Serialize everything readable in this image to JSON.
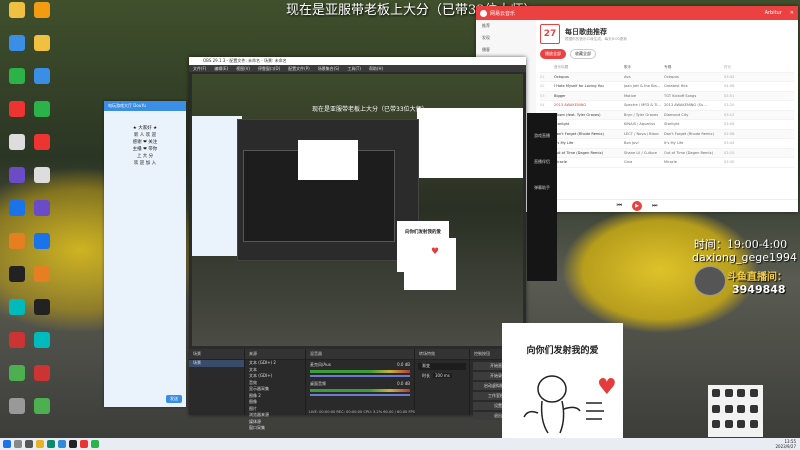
{
  "stream": {
    "title_overlay": "现在是亚服带老板上大分（已带33位大师）",
    "time_text": "时间：19:00-4:00",
    "username": "daxiong_gege1994",
    "platform_label": "斗鱼直播间：",
    "room_number": "3949848",
    "sticker_caption": "向你们发射我的爱",
    "watermark": "吊毛"
  },
  "netease": {
    "app_name": "网易云音乐",
    "user": "Arbitur",
    "sidebar": [
      "推荐",
      "发现",
      "播客",
      "私人漫游",
      "我的",
      "下载管理",
      "最近播放"
    ],
    "date_day": "27",
    "section_title": "每日歌曲推荐",
    "section_sub": "根据你的音乐口味生成，每天6:00更新",
    "play_all": "播放全部",
    "collect_all": "收藏全部",
    "columns": [
      "音乐标题",
      "歌手",
      "专辑",
      "时长"
    ],
    "songs": [
      {
        "n": "01",
        "title": "Octopus",
        "artist": "Ava",
        "album": "Octopus",
        "dur": "03:42"
      },
      {
        "n": "02",
        "title": "I Hate Myself for Loving You",
        "artist": "Joan Jett & the Bla...",
        "album": "Greatest Hits",
        "dur": "04:08"
      },
      {
        "n": "03",
        "title": "Bigger",
        "artist": "Motive",
        "album": "TGT Kickoff Songs",
        "dur": "03:51"
      },
      {
        "n": "04",
        "title": "2013 AWAKENING",
        "artist": "Spectre / MFD & Ti...",
        "album": "2013 AWAKENING (Su...",
        "dur": "03:20"
      },
      {
        "n": "05",
        "title": "Clown (feat. Tyler Graves)",
        "artist": "Bryn / Tyler Graves",
        "album": "Diamond City",
        "dur": "03:12"
      },
      {
        "n": "06",
        "title": "Starlight",
        "artist": "KINAIS / Aquarius",
        "album": "Starlight",
        "dur": "03:06"
      },
      {
        "n": "07",
        "title": "Don't Forget (Rhode Remix)",
        "artist": "LECT / Nova / Blanc",
        "album": "Don't Forget (Rhode Remix)",
        "dur": "02:58"
      },
      {
        "n": "08",
        "title": "It's My Life",
        "artist": "Bon Jovi",
        "album": "It's My Life",
        "dur": "03:44"
      },
      {
        "n": "09",
        "title": "Out of Time (Dagen Remix)",
        "artist": "Shane Lil / Culture",
        "album": "Out of Time (Dagen Remix)",
        "dur": "03:10"
      },
      {
        "n": "10",
        "title": "Miracle",
        "artist": "Gina",
        "album": "Miracle",
        "dur": "03:30"
      }
    ]
  },
  "obs": {
    "window_title": "OBS 29.1.3 - 配置文件: 未命名 - 场景: 未命名",
    "menu": [
      "文件(F)",
      "编辑(E)",
      "视图(V)",
      "停靠窗口(D)",
      "配置文件(P)",
      "场景集合(S)",
      "工具(T)",
      "帮助(H)"
    ],
    "preview_title": "现在是亚服带老板上大分（已带33位大师）",
    "docks": [
      "场景",
      "来源",
      "混音器",
      "转场特效",
      "控制按钮"
    ],
    "scene": "场景",
    "sources": [
      "文本 (GDI+) 2",
      "文本",
      "文本 (GDI+)",
      "音效",
      "显示器采集",
      "图像 2",
      "图像",
      "图片",
      "浏览器来源",
      "媒体源",
      "窗口采集"
    ],
    "mixer": [
      {
        "name": "麦克风/Aux",
        "db": "0.0 dB"
      },
      {
        "name": "桌面音频",
        "db": "0.0 dB"
      }
    ],
    "transition": "渐变",
    "duration_label": "时长",
    "duration": "300 ms",
    "controls": [
      "开始直播",
      "开始录制",
      "启动虚拟摄像机",
      "工作室模式",
      "设置",
      "退出"
    ],
    "status": "LIVE: 00:00:00  REC: 00:00:00  CPU: 3.2%  60.00 / 60.00 FPS"
  },
  "qq": {
    "title": "电玩游戏大厅 DouYu",
    "lines": [
      "★ 大家好 ★",
      "新 人 欢 迎",
      "感谢 ❤ 关注",
      "主播 ❤ 带你",
      "上 大 分",
      "欢 迎 加 入"
    ],
    "send_button": "发送"
  },
  "rdock": [
    "游戏直播",
    "直播伴侣",
    "弹幕助手"
  ],
  "taskbar": {
    "time": "13:55",
    "date": "2023/9/27"
  }
}
